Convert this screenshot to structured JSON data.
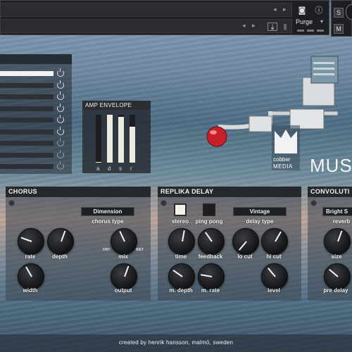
{
  "header": {
    "purge_label": "Purge"
  },
  "amp_envelope": {
    "title": "AMP ENVELOPE",
    "labels": [
      "a",
      "d",
      "s",
      "r"
    ],
    "levels": [
      0.02,
      1.0,
      0.95,
      0.75
    ]
  },
  "logo": {
    "line1": "cobber",
    "line2": "MEDIA"
  },
  "brand_title": "MUSI",
  "slider_list": {
    "active_index": 0,
    "count": 9
  },
  "chorus": {
    "title": "CHORUS",
    "mode": "Dimension",
    "mode_label": "chorus type",
    "knobs": {
      "rate": "rate",
      "depth": "depth",
      "mix": "mix",
      "width": "width",
      "output": "output"
    },
    "mix_dry": "DRY",
    "mix_wet": "WET"
  },
  "delay": {
    "title": "REPLIKA DELAY",
    "stereo": "stereo",
    "ping_pong": "ping pong",
    "type": "Vintage",
    "type_label": "delay type",
    "knobs": {
      "time": "time",
      "feedback": "feedback",
      "lo_cut": "lo cut",
      "hi_cut": "hi cut",
      "m_depth": "m. depth",
      "m_rate": "m. rate",
      "level": "level"
    }
  },
  "convolution": {
    "title": "CONVOLUTI",
    "type": "Bright S",
    "type_label": "reverb",
    "knobs": {
      "size": "size",
      "pre_delay": "pre delay"
    }
  },
  "footer": "created by henrik hansson, malmö, sweden"
}
